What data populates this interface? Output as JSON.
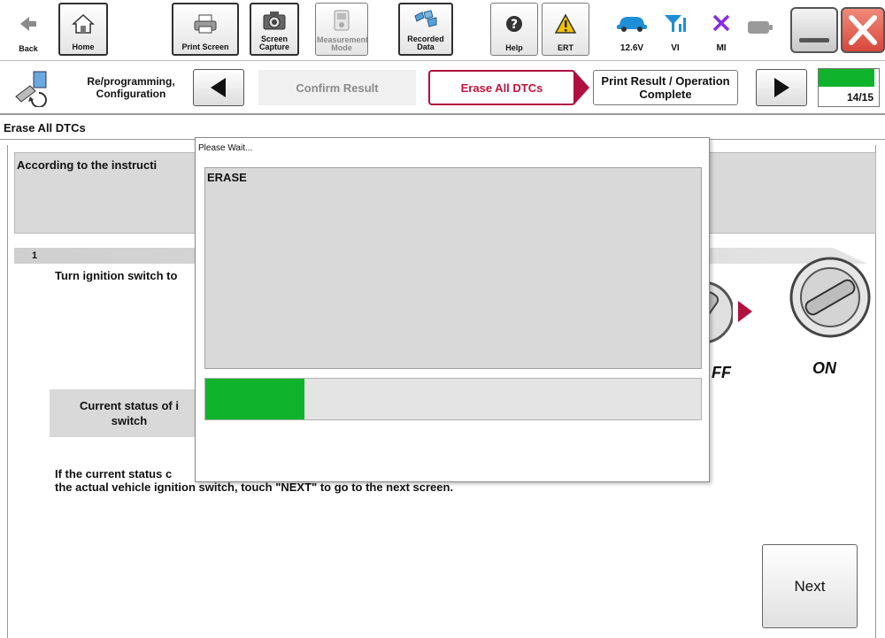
{
  "toolbar": {
    "back_label": "Back",
    "home_label": "Home",
    "print_screen_label": "Print Screen",
    "screen_capture_label": "Screen Capture",
    "measurement_mode_label": "Measurement Mode",
    "recorded_data_label": "Recorded Data",
    "help_label": "Help",
    "ert_label": "ERT",
    "battery_voltage": "12.6V",
    "vi_label": "VI",
    "mi_label": "MI"
  },
  "stepbar": {
    "mode_label": "Re/programming, Configuration",
    "steps": [
      {
        "label": "Confirm Result",
        "state": "inactive"
      },
      {
        "label": "Erase All DTCs",
        "state": "active"
      },
      {
        "label": "Print Result / Operation Complete",
        "state": "next"
      }
    ],
    "progress": {
      "current": 14,
      "total": 15,
      "text": "14/15"
    }
  },
  "page": {
    "title": "Erase All DTCs",
    "instruction": "According to the instructi",
    "step_number": "1",
    "step_text": "Turn ignition switch to",
    "status_label_line1": "Current status of i",
    "status_label_line2": "switch",
    "body_line1": "If the current status c",
    "body_line2": "the actual vehicle ignition switch, touch \"NEXT\" to go to the next screen.",
    "ignition_off_label": "FF",
    "ignition_on_label": "ON",
    "next_label": "Next"
  },
  "modal": {
    "title": "Please Wait...",
    "heading": "ERASE",
    "progress_fraction": 0.2
  },
  "colors": {
    "accent_red": "#c0143c",
    "progress_green": "#10b42c",
    "panel_gray": "#d9d9d9"
  },
  "icons": [
    "back-arrow-icon",
    "home-icon",
    "printer-icon",
    "camera-icon",
    "meter-icon",
    "recorded-data-icon",
    "help-icon",
    "warning-icon",
    "car-icon",
    "signal-icon",
    "mi-x-icon",
    "battery-icon",
    "minimize-icon",
    "close-icon",
    "reprogramming-icon",
    "ignition-switch-icon"
  ]
}
